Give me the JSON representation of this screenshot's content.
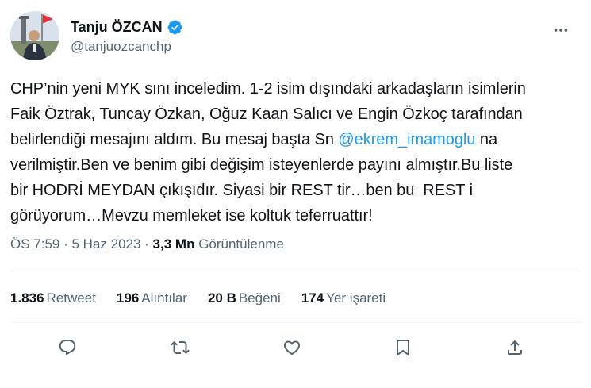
{
  "author": {
    "display_name": "Tanju ÖZCAN",
    "handle": "@tanjuozcanchp",
    "avatar_icon": "profile-photo",
    "verified_icon": "verified-badge-icon",
    "verified_color": "#1d9bf0"
  },
  "tweet": {
    "text_before_mention": "CHP’nin yeni MYK sını inceledim. 1-2 isim dışındaki arkadaşların isimlerin\nFaik Öztrak, Tuncay Özkan, Oğuz Kaan Salıcı ve Engin Özkoç tarafından\nbelirlendiği mesajını aldım. Bu mesaj başta Sn ",
    "mention": "@ekrem_imamoglu",
    "text_after_mention": " na\nverilmiştir.Ben ve benim gibi değişim isteyenlerde payını almıştır.Bu liste\nbir HODRİ MEYDAN çıkışıdır. Siyasi bir REST tir…ben bu  REST i\ngörüyorum…Mevzu memleket ise koltuk teferruattır!",
    "mention_color": "#1d9bf0"
  },
  "meta": {
    "time": "ÖS 7:59",
    "separator": " · ",
    "date": "5 Haz 2023",
    "views_count": "3,3 Mn",
    "views_label": "Görüntülenme"
  },
  "stats": {
    "retweets": {
      "count": "1.836",
      "label": "Retweet"
    },
    "quotes": {
      "count": "196",
      "label": "Alıntılar"
    },
    "likes": {
      "count": "20 B",
      "label": "Beğeni"
    },
    "bookmarks": {
      "count": "174",
      "label": "Yer işareti"
    }
  },
  "actions": {
    "reply_icon": "reply-icon",
    "retweet_icon": "retweet-icon",
    "like_icon": "heart-icon",
    "bookmark_icon": "bookmark-icon",
    "share_icon": "share-icon",
    "icon_color": "#536471"
  },
  "more_icon": "more-icon"
}
